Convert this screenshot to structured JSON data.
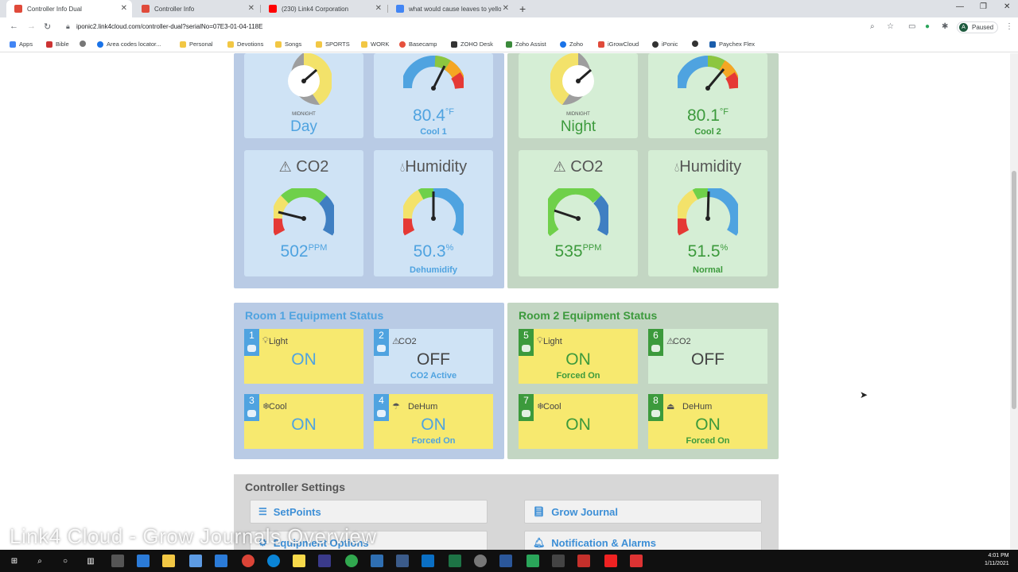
{
  "browser": {
    "tabs": [
      {
        "label": "Controller Info Dual",
        "active": true
      },
      {
        "label": "Controller Info",
        "active": false
      },
      {
        "label": "(230) Link4 Corporation",
        "active": false
      },
      {
        "label": "what would cause leaves to yello",
        "active": false
      }
    ],
    "url": "iponic2.link4cloud.com/controller-dual?serialNo=07E3-01-04-118E",
    "profile_status": "Paused",
    "profile_initial": "A",
    "bookmarks": [
      "Apps",
      "Bible",
      "Area codes locator...",
      "Personal",
      "Devotions",
      "Songs",
      "SPORTS",
      "WORK",
      "Basecamp",
      "ZOHO Desk",
      "Zoho Assist",
      "Zoho",
      "iGrowCloud",
      "iPonic",
      "Paychex Flex"
    ]
  },
  "room1": {
    "day_label": "Day",
    "midnight_label": "MIDNIGHT",
    "temp_value": "80.4",
    "temp_unit": "°F",
    "temp_mode": "Cool 1",
    "co2_title": "CO2",
    "co2_value": "502",
    "co2_unit": "PPM",
    "co2_pct": 0.3,
    "hum_title": "Humidity",
    "hum_value": "50.3",
    "hum_unit": "%",
    "hum_mode": "Dehumidify"
  },
  "room2": {
    "day_label": "Night",
    "midnight_label": "MIDNIGHT",
    "temp_value": "80.1",
    "temp_unit": "°F",
    "temp_mode": "Cool 2",
    "co2_title": "CO2",
    "co2_value": "535",
    "co2_unit": "PPM",
    "hum_title": "Humidity",
    "hum_value": "51.5",
    "hum_unit": "%",
    "hum_mode": "Normal"
  },
  "equipment": {
    "room1_title": "Room 1 Equipment Status",
    "room2_title": "Room 2 Equipment Status",
    "items": [
      {
        "num": "1",
        "label": "Light",
        "state": "ON",
        "note": ""
      },
      {
        "num": "2",
        "label": "CO2",
        "state": "OFF",
        "note": "CO2 Active"
      },
      {
        "num": "3",
        "label": "Cool",
        "state": "ON",
        "note": ""
      },
      {
        "num": "4",
        "label": "DeHum",
        "state": "ON",
        "note": "Forced On"
      },
      {
        "num": "5",
        "label": "Light",
        "state": "ON",
        "note": "Forced On"
      },
      {
        "num": "6",
        "label": "CO2",
        "state": "OFF",
        "note": ""
      },
      {
        "num": "7",
        "label": "Cool",
        "state": "ON",
        "note": ""
      },
      {
        "num": "8",
        "label": "DeHum",
        "state": "ON",
        "note": "Forced On"
      }
    ]
  },
  "settings": {
    "title": "Controller Settings",
    "setpoints": "SetPoints",
    "equipment_options": "Equipment Options",
    "grow_journal": "Grow Journal",
    "notifications": "Notification & Alarms"
  },
  "overlay": {
    "caption": "Link4 Cloud - Grow Journals Overview",
    "logo_text": "Link4"
  },
  "taskbar": {
    "time": "4:01 PM",
    "date": "1/11/2021"
  },
  "colors": {
    "room1_bg": "#b9cbe5",
    "room2_bg": "#c3d6c3",
    "room1_card": "#cfe3f5",
    "room2_card": "#d5eed5",
    "room1_accent": "#4fa3e0",
    "room2_accent": "#3c9a3c",
    "on_yellow": "#f7e96f"
  }
}
